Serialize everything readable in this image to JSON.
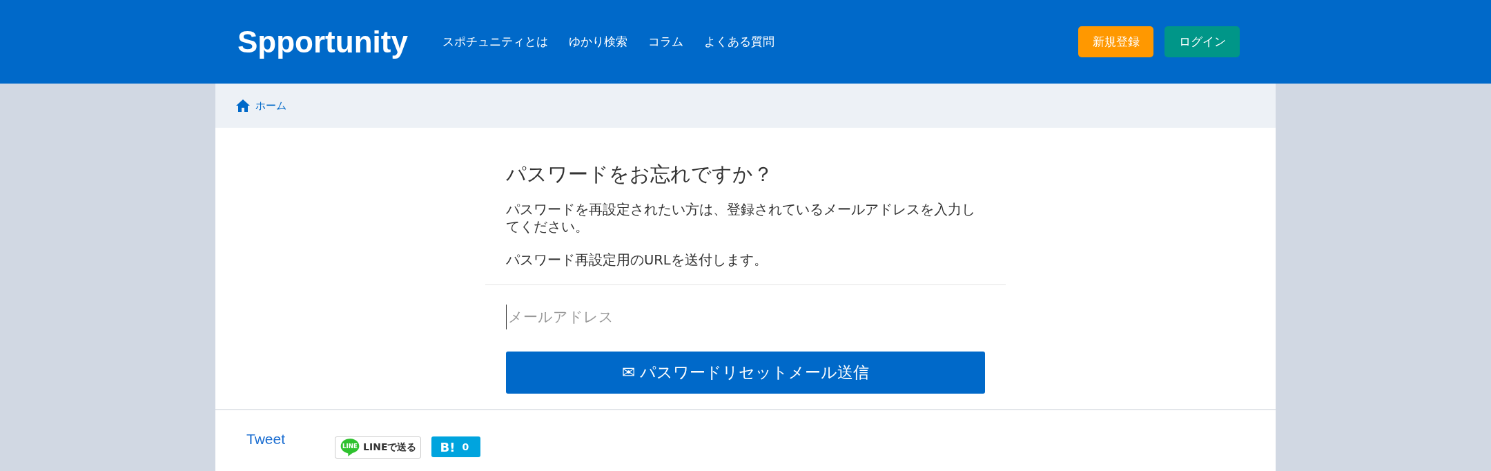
{
  "header": {
    "logo": "Spportunity",
    "nav": [
      {
        "label": "スポチュニティとは"
      },
      {
        "label": "ゆかり検索"
      },
      {
        "label": "コラム"
      },
      {
        "label": "よくある質問"
      }
    ],
    "buttons": [
      {
        "label": "新規登録",
        "kind": "signup"
      },
      {
        "label": "ログイン",
        "kind": "login"
      }
    ]
  },
  "breadcrumb": {
    "label": "ホーム"
  },
  "form": {
    "title": "パスワードをお忘れですか？",
    "paragraphs": [
      "パスワードを再設定されたい方は、登録されているメールアドレスを入力してください。",
      "パスワード再設定用のURLを送付します。"
    ],
    "email": {
      "placeholder": "メールアドレス"
    },
    "submit": {
      "icon": "✉",
      "label": "パスワードリセットメール送信"
    }
  },
  "share": {
    "tweet": "Tweet",
    "line": {
      "badge": "LINE",
      "label": "LINEで送る"
    },
    "hatena": {
      "mark": "B!",
      "count": "0"
    }
  }
}
